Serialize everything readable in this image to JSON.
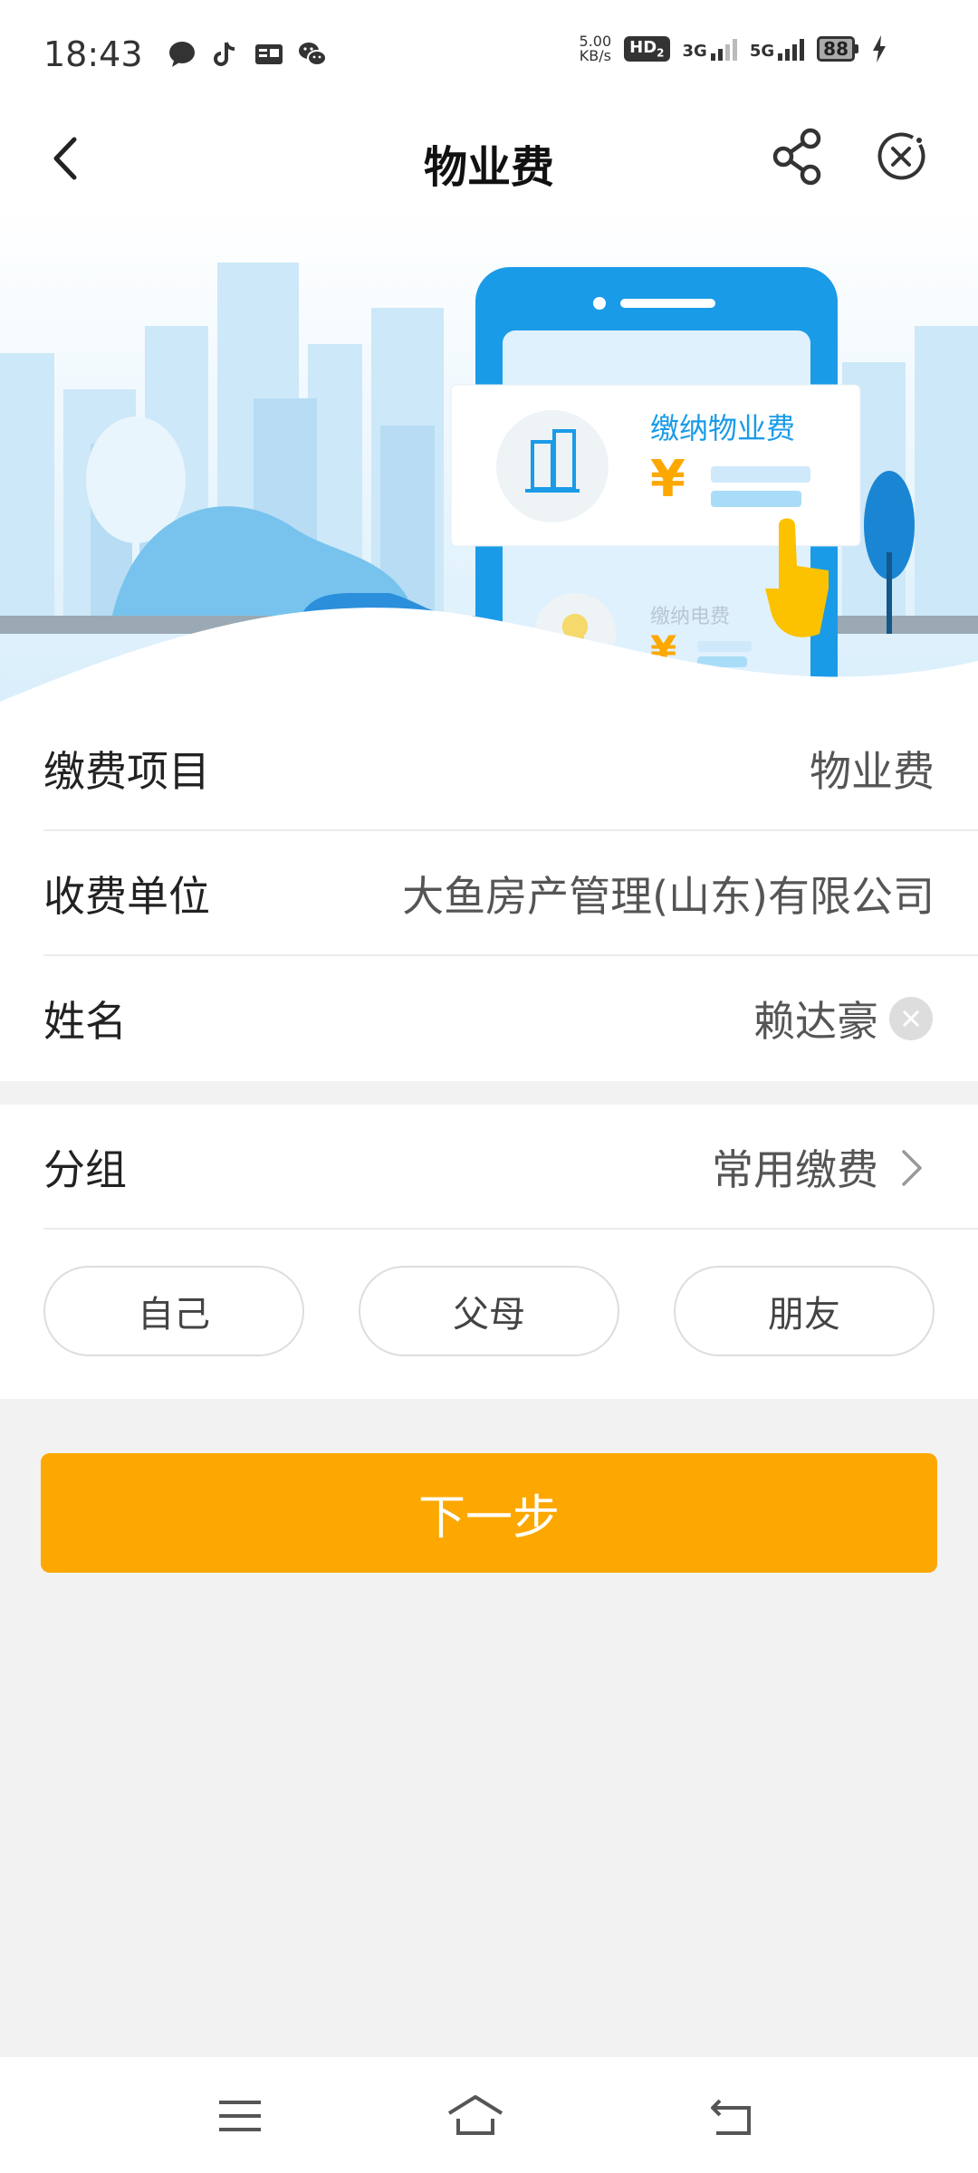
{
  "status_bar": {
    "time": "18:43",
    "net_speed_value": "5.00",
    "net_speed_unit": "KB/s",
    "hd_label": "HD",
    "hd_sub": "2",
    "signal_1_label": "3G",
    "signal_2_label": "5G",
    "battery": "88",
    "icons": [
      "message-icon",
      "tiktok-icon",
      "toutiao-icon",
      "wechat-icon",
      "charging-icon"
    ]
  },
  "header": {
    "title": "物业费"
  },
  "banner": {
    "card_title": "缴纳物业费",
    "card_currency": "¥",
    "secondary_title": "缴纳电费",
    "secondary_currency": "¥"
  },
  "form": {
    "item_label": "缴费项目",
    "item_value": "物业费",
    "company_label": "收费单位",
    "company_value": "大鱼房产管理(山东)有限公司",
    "name_label": "姓名",
    "name_value": "赖达豪"
  },
  "group": {
    "label": "分组",
    "value": "常用缴费",
    "chips": [
      "自己",
      "父母",
      "朋友"
    ]
  },
  "next_button": "下一步",
  "colors": {
    "accent": "#fca800",
    "banner_blue": "#1a9be8"
  }
}
